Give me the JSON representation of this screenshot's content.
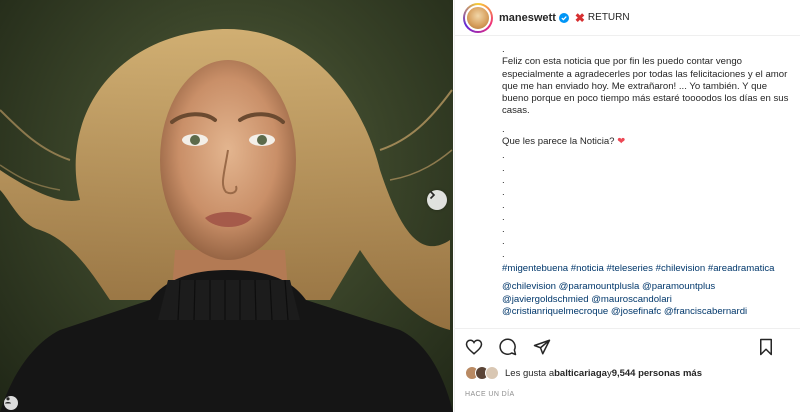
{
  "post": {
    "username": "maneswett",
    "badge_icon": "verified-badge-icon",
    "flag_symbol": "✖",
    "header_tag": "RETURN"
  },
  "caption": {
    "lines": [
      ".",
      "Feliz con esta noticia que por fin les puedo contar vengo especialmente a agradecerles por todas las felicitaciones y el amor que me han enviado hoy. Me extrañaron! ... Yo también. Y que bueno porque en poco tiempo más estaré toooodos los días en sus casas.",
      "."
    ],
    "question": "Que les parece la Noticia?",
    "heart": "❤",
    "dots": [
      ".",
      ".",
      ".",
      ".",
      ".",
      ".",
      ".",
      ".",
      "."
    ],
    "hashtags": "#migentebuena #noticia #teleseries #chilevision #areadramatica",
    "mentions_1": "@chilevision @paramountplusla @paramountplus",
    "mentions_2": "@javiergoldschmied @mauroscandolari",
    "mentions_3": "@cristianriquelmecroque @josefinafc @franciscabernardi"
  },
  "likes": {
    "prefix": "Les gusta a ",
    "user": "balticariaga",
    "middle": " y ",
    "count": "9,544 personas más"
  },
  "timestamp": "HACE UN DÍA",
  "colors": {
    "accent_link": "#00376b",
    "heart": "#ed4956",
    "verified": "#0095f6",
    "cross": "#d63031"
  }
}
